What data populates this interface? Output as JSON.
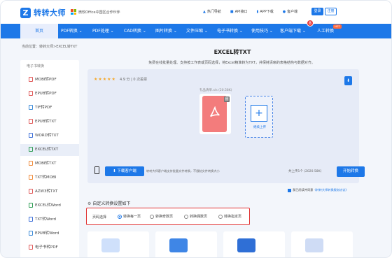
{
  "brand": {
    "logo_letter": "Z",
    "name": "转转大师",
    "partner": "微软Office中国区合作伙伴"
  },
  "toplinks": [
    {
      "icon": "fire-icon",
      "label": "热门导航"
    },
    {
      "icon": "api-icon",
      "label": "API接口"
    },
    {
      "icon": "phone-icon",
      "label": "APP下载"
    },
    {
      "icon": "user-icon",
      "label": "客户端"
    }
  ],
  "auth": {
    "login": "登录",
    "register": "注册"
  },
  "nav": {
    "home": "首页",
    "items": [
      "PDF转换",
      "PDF处理",
      "CAD转换",
      "图片转换",
      "文件压缩",
      "电子书转换",
      "使用技巧",
      "客户端下载",
      "人工转换"
    ],
    "hot_badge": "HOT",
    "notification_count": "8"
  },
  "breadcrumb": "当前位置：转转大师>EXCEL转TXT",
  "sidebar": {
    "title": "电子书转换",
    "items": [
      "MOBI转PDF",
      "EPUB转PDF",
      "TIF转PDF",
      "EPUB转TXT",
      "WORD转TXT",
      "EXCEL转TXT",
      "MOBI转TXT",
      "TXT转MOBI",
      "AZW3转TXT",
      "EXCEL转Word",
      "TXT转Word",
      "EPUB转Word",
      "电子书转PDF"
    ],
    "active_index": 5
  },
  "main": {
    "title": "EXCEL转TXT",
    "subtitle": "免费在线批量处理、支持按工作表或页码选择，将Excel精准转为TXT，并保持清晰的表格结构与数据对齐。"
  },
  "panel": {
    "stars": "★★★★★",
    "rating": "4.9 分 | 0 次投票",
    "file_name": "礼品清单.xls (20.58K)",
    "add_label": "继续上传",
    "download_btn": "下载客户端",
    "download_hint": "转转大师客户端支持批量文件转换，不限制文件转换大小",
    "count_text": "共上传1个 (2020.58K)",
    "start_btn": "开始转换"
  },
  "agree": {
    "text": "我已阅读并同意",
    "link": "《转转大师转换服务协议》"
  },
  "settings": {
    "title": "自定义转换设置如下",
    "option_label": "页码选择",
    "options": [
      "转换每一页",
      "转换奇数页",
      "转换偶数页",
      "转换指定页"
    ],
    "selected_index": 0
  },
  "colors": {
    "accent": "#1d78e8",
    "pdf": "#f37c7c",
    "highlight_border": "#e03131"
  }
}
